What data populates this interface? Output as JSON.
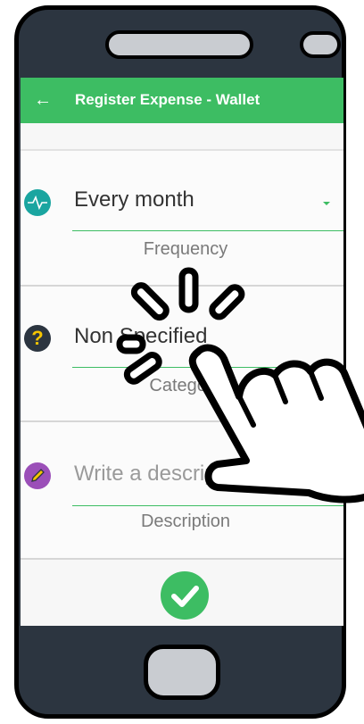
{
  "appbar": {
    "title": "Register Expense - Wallet",
    "back_icon": "arrow-left-icon"
  },
  "fields": {
    "frequency": {
      "value": "Every month",
      "caption": "Frequency",
      "icon": "pulse-icon",
      "icon_color": "#1aa5a0"
    },
    "category": {
      "value": "Non Specified",
      "caption": "Category",
      "icon": "question-icon",
      "icon_color": "#f5c400"
    },
    "description": {
      "placeholder": "Write a description",
      "caption": "Description",
      "icon": "pencil-icon",
      "icon_color": "#9b4fb8"
    }
  },
  "confirm": {
    "icon": "check-icon"
  },
  "colors": {
    "accent": "#3dbd63",
    "phone_body": "#2c3540"
  }
}
